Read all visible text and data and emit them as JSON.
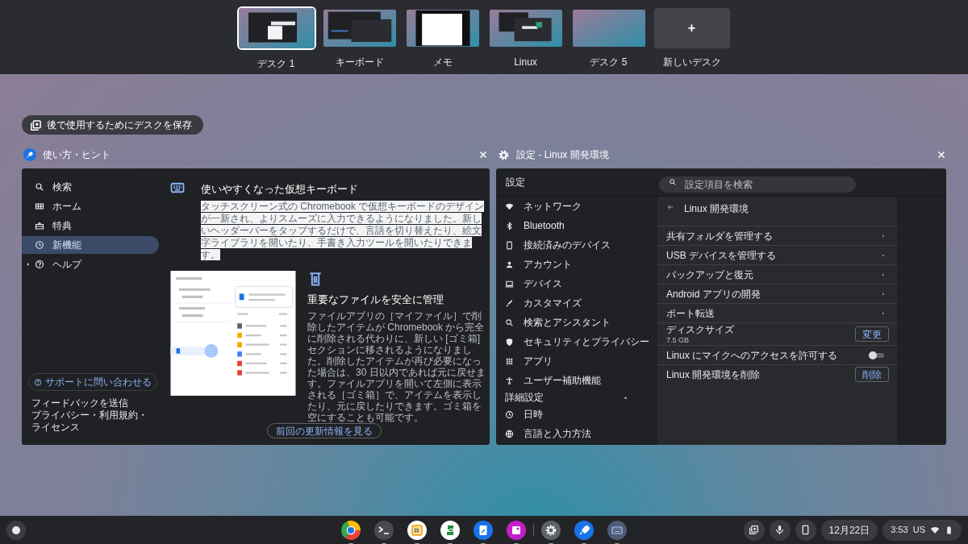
{
  "desks": [
    {
      "label": "デスク 1",
      "selected": true
    },
    {
      "label": "キーボード",
      "selected": false
    },
    {
      "label": "メモ",
      "selected": false
    },
    {
      "label": "Linux",
      "selected": false
    },
    {
      "label": "デスク 5",
      "selected": false
    }
  ],
  "new_desk": {
    "icon": "+",
    "label": "新しいデスク"
  },
  "save_desk_button": "後で使用するためにデスクを保存",
  "tips_window": {
    "title": "使い方・ヒント",
    "sidebar": [
      {
        "label": "検索",
        "kind": "page",
        "selected": false
      },
      {
        "label": "ホーム",
        "kind": "page",
        "selected": false
      },
      {
        "label": "特典",
        "kind": "page",
        "selected": false
      },
      {
        "label": "新機能",
        "kind": "page",
        "selected": true
      },
      {
        "label": "ヘルプ",
        "kind": "group",
        "selected": false
      }
    ],
    "support_button": "サポートに問い合わせる",
    "footer_links": [
      "フィードバックを送信",
      "プライバシー・利用規約・ライセンス"
    ],
    "articles": [
      {
        "kind": "keyboard",
        "title": "使いやすくなった仮想キーボード",
        "body": "タッチスクリーン式の Chromebook で仮想キーボードのデザインが一新され、よりスムーズに入力できるようになりました。新しいヘッダーバーをタップするだけで、言語を切り替えたり、絵文字ライブラリを開いたり、手書き入力ツールを開いたりできます。",
        "selected": true
      },
      {
        "kind": "trash",
        "title": "重要なファイルを安全に管理",
        "body": "ファイルアプリの［マイファイル］で削除したアイテムが Chromebook から完全に削除される代わりに、新しい [ゴミ箱] セクションに移されるようになりました。削除したアイテムが再び必要になった場合は、30 日以内であれば元に戻せます。ファイルアプリを開いて左側に表示される［ゴミ箱］で、アイテムを表示したり、元に戻したりできます。ゴミ箱を空にすることも可能です。",
        "selected": false
      }
    ],
    "more_button": "前回の更新情報を見る"
  },
  "settings_window": {
    "title": "設定 - Linux 開発環境",
    "app_title": "設定",
    "search": {
      "placeholder": "設定項目を検索"
    },
    "nav": [
      "ネットワーク",
      "Bluetooth",
      "接続済みのデバイス",
      "アカウント",
      "デバイス",
      "カスタマイズ",
      "検索とアシスタント",
      "セキュリティとプライバシー",
      "アプリ",
      "ユーザー補助機能"
    ],
    "advanced": {
      "label": "詳細設定",
      "expanded": true,
      "items": [
        "日時",
        "言語と入力方法"
      ]
    },
    "page": {
      "title": "Linux 開発環境",
      "rows": [
        {
          "kind": "link",
          "label": "共有フォルダを管理する"
        },
        {
          "kind": "link",
          "label": "USB デバイスを管理する"
        },
        {
          "kind": "link",
          "label": "バックアップと復元"
        },
        {
          "kind": "link",
          "label": "Android アプリの開発"
        },
        {
          "kind": "link",
          "label": "ポート転送"
        },
        {
          "kind": "button",
          "label": "ディスクサイズ",
          "sublabel": "7.5 GB",
          "button": "変更"
        },
        {
          "kind": "toggle",
          "label": "Linux にマイクへのアクセスを許可する",
          "on": false
        },
        {
          "kind": "button",
          "label": "Linux 開発環境を削除",
          "button": "削除"
        }
      ]
    }
  },
  "shelf": {
    "pinned": [
      {
        "running": true
      },
      {
        "running": true
      },
      {
        "running": true
      },
      {
        "running": true
      },
      {
        "running": true
      },
      {
        "running": true
      }
    ],
    "others": [
      {
        "running": true
      },
      {
        "running": true
      },
      {
        "running": true
      }
    ],
    "date": "12月22日",
    "time": "3:53",
    "ime": "US"
  }
}
